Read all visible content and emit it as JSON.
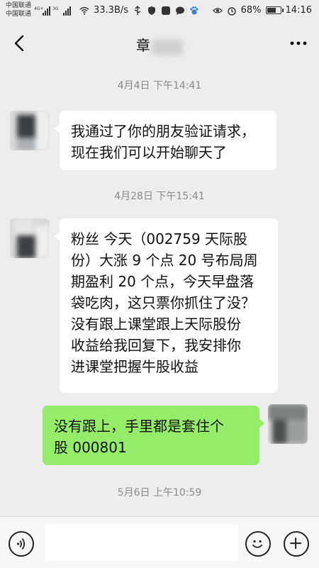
{
  "status_bar": {
    "carrier1": "中国联通",
    "carrier2": "中国联通",
    "net1": "4G+",
    "net2": "3G",
    "speed": "33.3B/s",
    "battery": "68%",
    "battery_level": 0.68,
    "time": "14:16"
  },
  "header": {
    "title": "章",
    "back_icon": "chevron-left-icon",
    "more_icon": "more-dots-icon"
  },
  "messages": [
    {
      "type": "timestamp",
      "text": "4月4日 下午14:41"
    },
    {
      "type": "message",
      "side": "left",
      "lines": [
        "我通过了你的朋友验证请求，",
        "现在我们可以开始聊天了"
      ]
    },
    {
      "type": "timestamp",
      "text": "4月28日 下午15:41"
    },
    {
      "type": "message",
      "side": "left",
      "lines": [
        "粉丝 今天（002759 天际股",
        "份）大涨 9 个点 20 号布局周",
        "期盈利 20 个点，今天早盘落",
        "袋吃肉，这只票你抓住了没？",
        "没有跟上课堂跟上天际股份",
        "收益给我回复下，我安排你",
        "进课堂把握牛股收益"
      ]
    },
    {
      "type": "message",
      "side": "right",
      "lines": [
        "没有跟上，手里都是套住个",
        "股 000801"
      ]
    },
    {
      "type": "timestamp",
      "text": "5月6日 上午10:59"
    }
  ],
  "input_bar": {
    "voice_icon": "voice-icon",
    "emoji_icon": "emoji-icon",
    "plus_icon": "plus-icon",
    "placeholder": ""
  },
  "colors": {
    "background": "#ededed",
    "right_bubble": "#95ec69",
    "left_bubble": "#ffffff"
  }
}
